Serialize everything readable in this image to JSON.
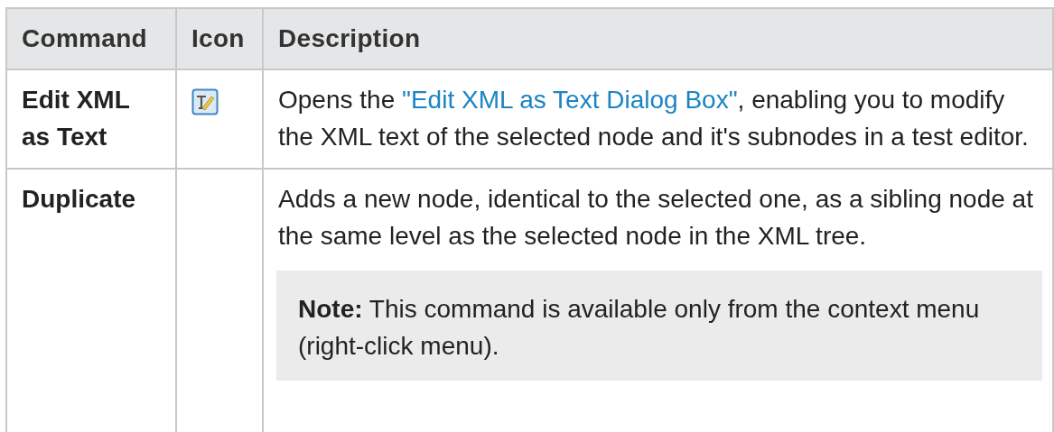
{
  "table": {
    "columns": [
      "Command",
      "Icon",
      "Description"
    ],
    "rows": [
      {
        "command": "Edit XML as Text",
        "has_icon": true,
        "description": {
          "before": "Opens the ",
          "link": "\"Edit XML as Text Dialog Box\"",
          "after": ", enabling you to modify the XML text of the selected node and it's subnodes in a test editor."
        }
      },
      {
        "command": "Duplicate",
        "has_icon": false,
        "description": {
          "before": "Adds a new node, identical to the selected one, as a sibling node at the same level as the selected node in the XML tree."
        },
        "note": {
          "label": "Note:",
          "text": " This command is available only from the context menu (right-click menu)."
        }
      }
    ]
  }
}
